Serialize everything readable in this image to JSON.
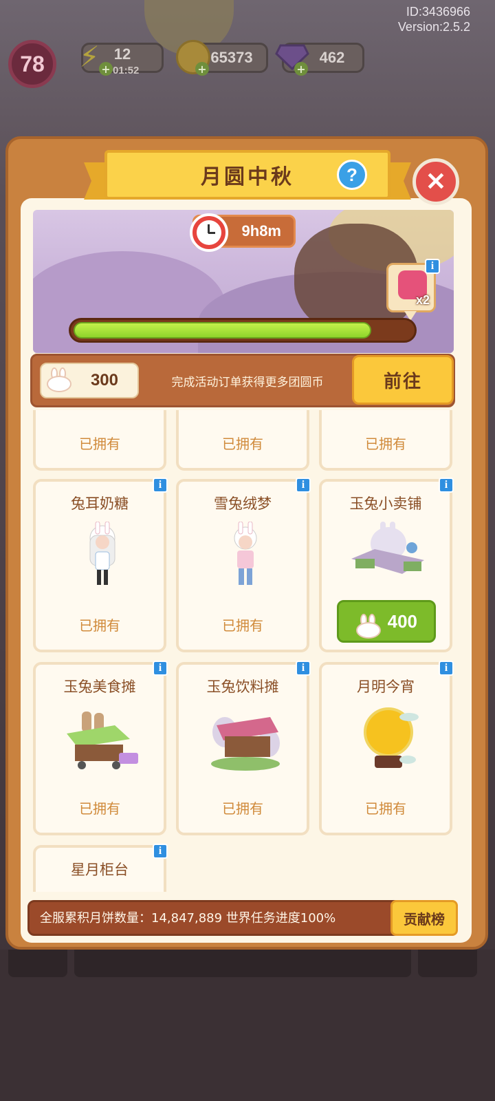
{
  "meta": {
    "id": "ID:3436966",
    "version": "Version:2.5.2"
  },
  "hud": {
    "level": "78",
    "energy": "12",
    "energy_timer": "01:52",
    "coins": "65373",
    "gems": "462"
  },
  "panel": {
    "title": "月圆中秋",
    "timer": "9h8m",
    "reward_count": "x2",
    "progress": 0.88,
    "currency_amount": "300",
    "currency_hint": "完成活动订单获得更多团圆币",
    "go_label": "前往"
  },
  "items": [
    {
      "name": "",
      "status": "已拥有"
    },
    {
      "name": "",
      "status": "已拥有"
    },
    {
      "name": "",
      "status": "已拥有"
    },
    {
      "name": "兔耳奶糖",
      "status": "已拥有"
    },
    {
      "name": "雪兔绒梦",
      "status": "已拥有"
    },
    {
      "name": "玉兔小卖铺",
      "price": "400"
    },
    {
      "name": "玉兔美食摊",
      "status": "已拥有"
    },
    {
      "name": "玉兔饮料摊",
      "status": "已拥有"
    },
    {
      "name": "月明今宵",
      "status": "已拥有"
    },
    {
      "name": "星月柜台"
    }
  ],
  "footer": {
    "text": "全服累积月饼数量：14,847,889  世界任务进度100%",
    "button": "贡献榜"
  },
  "colors": {
    "accent": "#fbc83b",
    "panel": "#c9823f",
    "progress": "#8fd52b",
    "buy": "#7dbb2a"
  }
}
